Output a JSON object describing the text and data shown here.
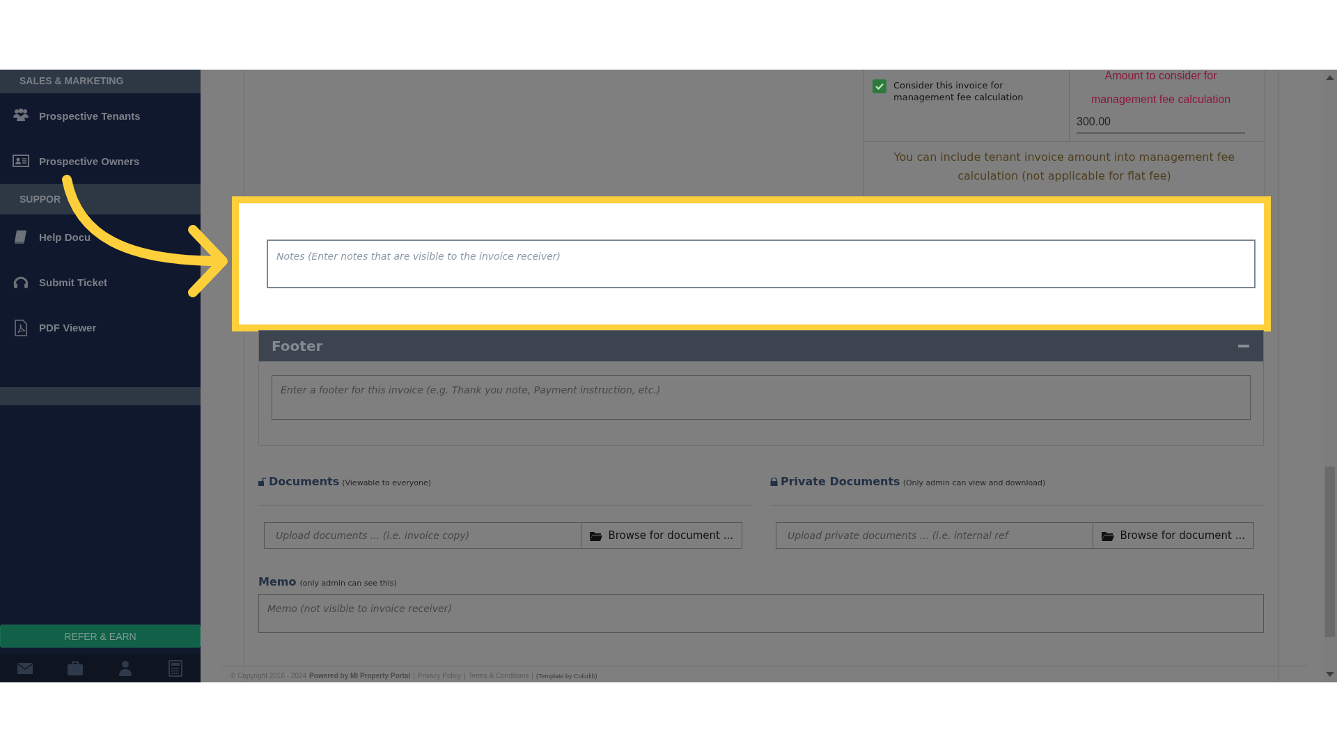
{
  "sidebar": {
    "sections": [
      {
        "title": "SALES & MARKETING",
        "items": [
          {
            "label": "Prospective Tenants"
          },
          {
            "label": "Prospective Owners"
          }
        ]
      },
      {
        "title": "SUPPOR",
        "items": [
          {
            "label": "Help Docu"
          },
          {
            "label": "Submit Ticket"
          },
          {
            "label": "PDF Viewer"
          }
        ]
      }
    ],
    "refer_button": "REFER & EARN"
  },
  "management_fee": {
    "checkbox": {
      "label": "Consider this invoice for management fee calculation",
      "checked": true
    },
    "amount_label": "Amount to consider for management fee calculation",
    "amount": "300.00",
    "note": "You can include tenant invoice amount into management fee calculation (not applicable for flat fee)"
  },
  "notes": {
    "placeholder": "Notes (Enter notes that are visible to the invoice receiver)",
    "highlighted": true
  },
  "footer_panel": {
    "title": "Footer",
    "expanded": true,
    "placeholder": "Enter a footer for this invoice (e.g. Thank you note, Payment instruction, etc.)"
  },
  "documents": [
    {
      "kind": "public",
      "title": "Documents",
      "hint": "(Viewable to everyone)",
      "placeholder": "Upload documents ... (i.e. invoice copy)",
      "button": "Browse for document ..."
    },
    {
      "kind": "private",
      "title": "Private Documents",
      "hint": "(Only admin can view and download)",
      "placeholder": "Upload private documents ... (i.e. internal ref",
      "button": "Browse for document ..."
    }
  ],
  "memo": {
    "title": "Memo",
    "hint": "(only admin can see this)",
    "placeholder": "Memo (not visible to invoice receiver)"
  },
  "copyright": {
    "text": "© Copyright 2016 - 2024",
    "brand": "Powered by MI Property Portal",
    "separator": "|",
    "links": [
      "Privacy Policy",
      "Terms & Conditions"
    ],
    "credit": "(Template by Colorlib)"
  }
}
